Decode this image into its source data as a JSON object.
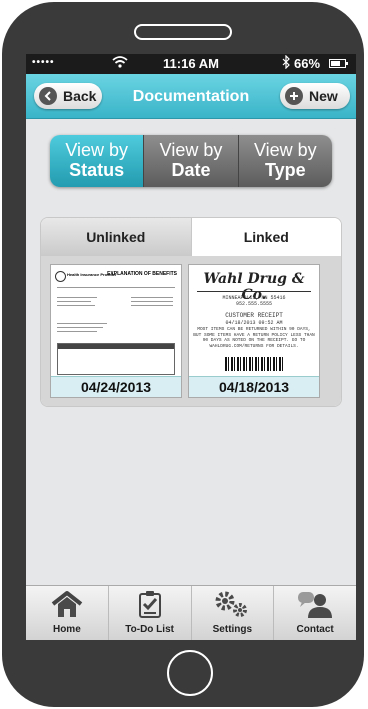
{
  "status_bar": {
    "carrier": "•••••",
    "time": "11:16 AM",
    "battery": "66%",
    "battery_level": 0.66
  },
  "nav": {
    "title": "Documentation",
    "back_label": "Back",
    "new_label": "New"
  },
  "view_options": [
    {
      "top": "View by",
      "bottom": "Status",
      "selected": true
    },
    {
      "top": "View by",
      "bottom": "Date",
      "selected": false
    },
    {
      "top": "View by",
      "bottom": "Type",
      "selected": false
    }
  ],
  "link_tabs": {
    "unlinked": "Unlinked",
    "linked": "Linked"
  },
  "documents": [
    {
      "date": "04/24/2013",
      "heading": "EXPLANATION OF BENEFITS",
      "provider": "Health Insurance Provider"
    },
    {
      "date": "04/18/2013",
      "store": "Wahl Drug & Co.",
      "location": "MINNEAPOLIS, MN 55416",
      "phone": "952.555.5555",
      "receipt_label": "CUSTOMER RECEIPT",
      "receipt_datetime": "04/18/2013 09:52 AM",
      "notice": "MOST ITEMS CAN BE RETURNED WITHIN 90 DAYS, BUT SOME ITEMS HAVE A RETURN POLICY LESS THAN 90 DAYS AS NOTED ON THE RECEIPT. GO TO WAHLDRUG.COM/RETURNS FOR DETAILS."
    }
  ],
  "tab_bar": [
    {
      "label": "Home",
      "icon": "home-icon"
    },
    {
      "label": "To-Do List",
      "icon": "clipboard-check-icon"
    },
    {
      "label": "Settings",
      "icon": "gears-icon"
    },
    {
      "label": "Contact",
      "icon": "chat-person-icon"
    }
  ],
  "colors": {
    "accent": "#3ab4c8",
    "phone_body": "#3a3a3a"
  }
}
